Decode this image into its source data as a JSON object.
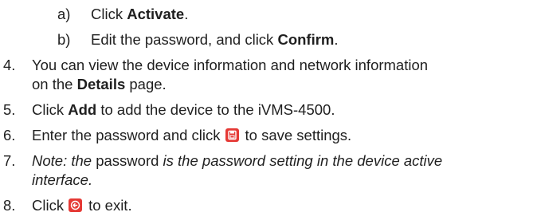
{
  "substeps": [
    {
      "label": "a)",
      "pre": "Click ",
      "bold": "Activate",
      "post": "."
    },
    {
      "label": "b)",
      "pre": "Edit the password, and click ",
      "bold": "Confirm",
      "post": "."
    }
  ],
  "step4": {
    "num": "4.",
    "line1": "You can view the device information and network information",
    "line2_pre": "on the ",
    "line2_bold": "Details",
    "line2_post": " page."
  },
  "step5": {
    "num": "5.",
    "pre": "Click ",
    "bold": "Add",
    "post": " to add the device to the iVMS-4500."
  },
  "step6": {
    "num": "6.",
    "pre": "Enter the password and click",
    "post": "to save settings.",
    "icon": "save-icon",
    "icon_color": "#e53935"
  },
  "step7": {
    "num": "7.",
    "line1_a": "Note: the ",
    "line1_b": "password",
    "line1_c": " is the password setting in the device active",
    "line2": "interface."
  },
  "step8": {
    "num": "8.",
    "pre": "Click",
    "post": "to exit.",
    "icon": "exit-icon",
    "icon_color": "#e53935"
  }
}
